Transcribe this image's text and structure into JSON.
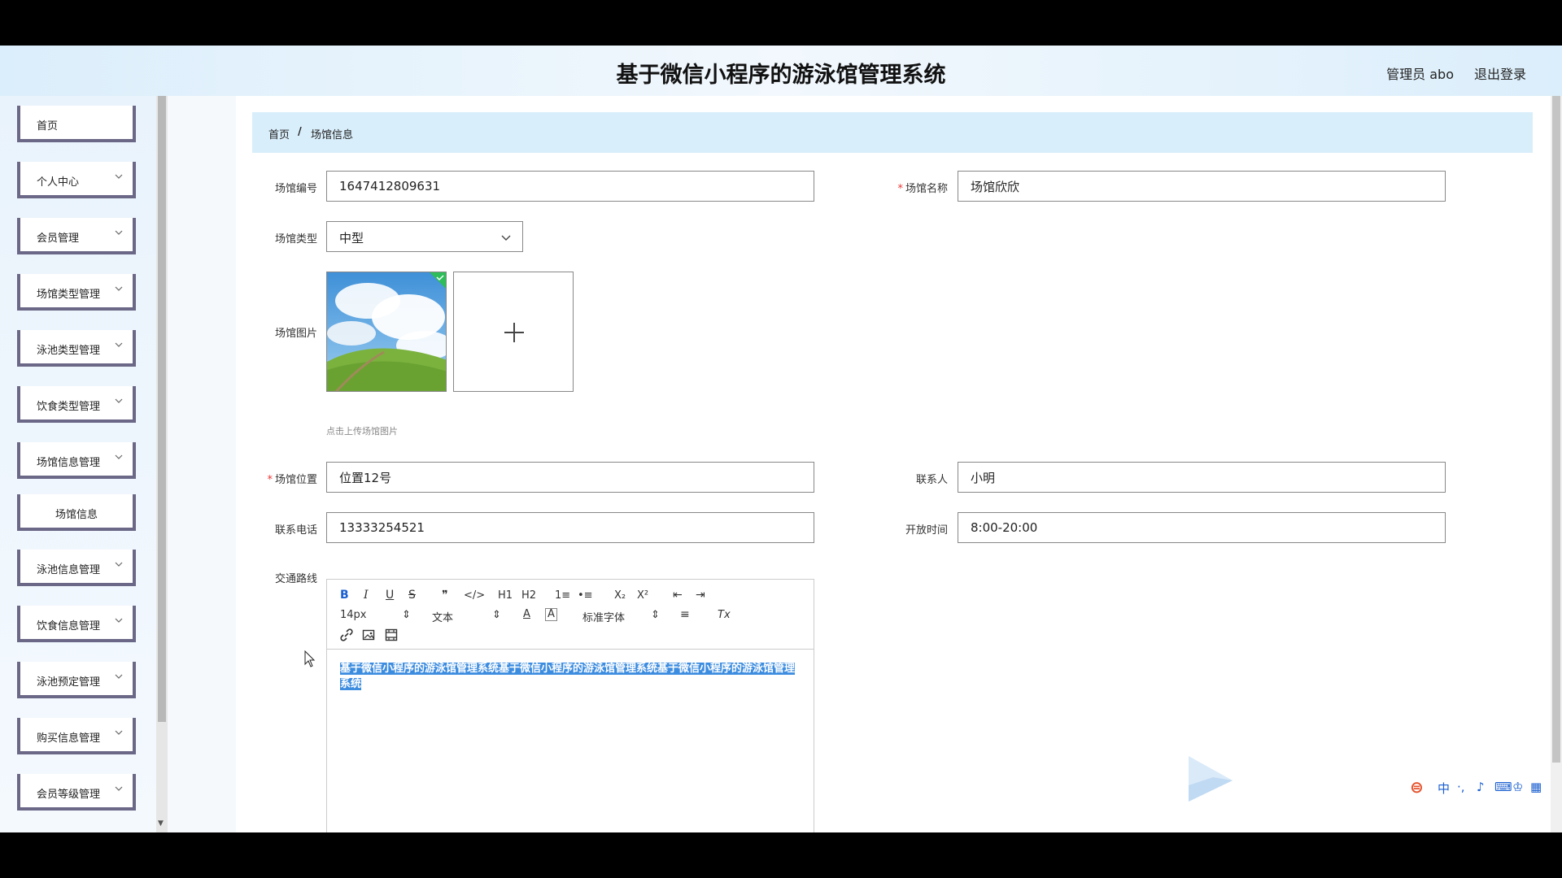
{
  "header": {
    "title": "基于微信小程序的游泳馆管理系统",
    "user": "管理员 abo",
    "logout": "退出登录"
  },
  "sidebar": {
    "items": [
      {
        "label": "首页"
      },
      {
        "label": "个人中心"
      },
      {
        "label": "会员管理"
      },
      {
        "label": "场馆类型管理"
      },
      {
        "label": "泳池类型管理"
      },
      {
        "label": "饮食类型管理"
      },
      {
        "label": "场馆信息管理"
      },
      {
        "label": "场馆信息"
      },
      {
        "label": "泳池信息管理"
      },
      {
        "label": "饮食信息管理"
      },
      {
        "label": "泳池预定管理"
      },
      {
        "label": "购买信息管理"
      },
      {
        "label": "会员等级管理"
      }
    ]
  },
  "breadcrumb": {
    "home": "首页",
    "sep": "/",
    "current": "场馆信息"
  },
  "form": {
    "venue_no": {
      "label": "场馆编号",
      "value": "1647412809631"
    },
    "venue_name": {
      "label": "场馆名称",
      "value": "场馆欣欣",
      "required": "*"
    },
    "venue_type": {
      "label": "场馆类型",
      "value": "中型"
    },
    "venue_image": {
      "label": "场馆图片",
      "hint": "点击上传场馆图片"
    },
    "venue_location": {
      "label": "场馆位置",
      "value": "位置12号",
      "required": "*"
    },
    "contact": {
      "label": "联系人",
      "value": "小明"
    },
    "phone": {
      "label": "联系电话",
      "value": "13333254521"
    },
    "open_time": {
      "label": "开放时间",
      "value": "8:00-20:00"
    },
    "route": {
      "label": "交通路线",
      "content": "基于微信小程序的游泳馆管理系统基于微信小程序的游泳馆管理系统基于微信小程序的游泳馆管理系统"
    }
  },
  "editor": {
    "font_size": "14px",
    "paragraph": "文本",
    "font_family": "标准字体",
    "buttons": [
      "B",
      "I",
      "U",
      "S",
      "❞",
      "</>",
      "H1",
      "H2",
      "1≡",
      "•≡",
      "X₂",
      "X²",
      "⇤",
      "⇥",
      "A",
      "A",
      "≡",
      "Tx"
    ]
  },
  "colors": {
    "header_bg": "#dbeefb",
    "breadcrumb_bg": "#d9eefb",
    "menu_border": "#6b6887",
    "selection": "#3c8ce0"
  }
}
